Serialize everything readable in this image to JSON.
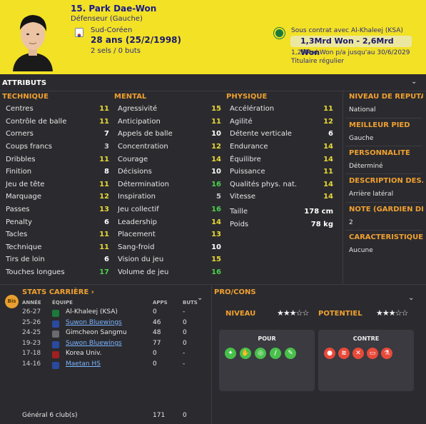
{
  "player": {
    "name": "15. Park Dae-Won",
    "position": "Défenseur (Gauche)",
    "nationality": "Sud-Coréen",
    "age": "28 ans (25/2/1998)",
    "caps": "2 sels / 0 buts",
    "contract": "Sous contrat avec Al-Khaleej (KSA)",
    "wage": "1,3Mrd Won - 2,6Mrd Won",
    "wage_detail": "1,28Mrd Won p/a jusqu'au 30/6/2029",
    "status": "Titulaire régulier"
  },
  "attributes": {
    "title": "ATTRIBUTS",
    "technique": {
      "title": "TECHNIQUE",
      "rows": [
        {
          "name": "Centres",
          "value": "11"
        },
        {
          "name": "Contrôle de balle",
          "value": "11"
        },
        {
          "name": "Corners",
          "value": "7"
        },
        {
          "name": "Coups francs",
          "value": "3"
        },
        {
          "name": "Dribbles",
          "value": "11"
        },
        {
          "name": "Finition",
          "value": "8"
        },
        {
          "name": "Jeu de tête",
          "value": "11"
        },
        {
          "name": "Marquage",
          "value": "12"
        },
        {
          "name": "Passes",
          "value": "13"
        },
        {
          "name": "Penalty",
          "value": "6"
        },
        {
          "name": "Tacles",
          "value": "11"
        },
        {
          "name": "Technique",
          "value": "11"
        },
        {
          "name": "Tirs de loin",
          "value": "6"
        },
        {
          "name": "Touches longues",
          "value": "17"
        }
      ]
    },
    "mental": {
      "title": "MENTAL",
      "rows": [
        {
          "name": "Agressivité",
          "value": "15"
        },
        {
          "name": "Anticipation",
          "value": "11"
        },
        {
          "name": "Appels de balle",
          "value": "10"
        },
        {
          "name": "Concentration",
          "value": "12"
        },
        {
          "name": "Courage",
          "value": "14"
        },
        {
          "name": "Décisions",
          "value": "10"
        },
        {
          "name": "Détermination",
          "value": "16"
        },
        {
          "name": "Inspiration",
          "value": "5"
        },
        {
          "name": "Jeu collectif",
          "value": "16"
        },
        {
          "name": "Leadership",
          "value": "14"
        },
        {
          "name": "Placement",
          "value": "13"
        },
        {
          "name": "Sang-froid",
          "value": "10"
        },
        {
          "name": "Vision du jeu",
          "value": "15"
        },
        {
          "name": "Volume de jeu",
          "value": "16"
        }
      ]
    },
    "physique": {
      "title": "PHYSIQUE",
      "rows": [
        {
          "name": "Accélération",
          "value": "11"
        },
        {
          "name": "Agilité",
          "value": "12"
        },
        {
          "name": "Détente verticale",
          "value": "6"
        },
        {
          "name": "Endurance",
          "value": "14"
        },
        {
          "name": "Équilibre",
          "value": "14"
        },
        {
          "name": "Puissance",
          "value": "11"
        },
        {
          "name": "Qualités phys. nat.",
          "value": "14"
        },
        {
          "name": "Vitesse",
          "value": "14"
        }
      ],
      "height_label": "Taille",
      "height": "178 cm",
      "weight_label": "Poids",
      "weight": "78 kg"
    }
  },
  "side": [
    {
      "title": "NIVEAU DE RÉPUTA...",
      "value": "National"
    },
    {
      "title": "MEILLEUR PIED",
      "value": "Gauche"
    },
    {
      "title": "PERSONNALITÉ",
      "value": "Déterminé"
    },
    {
      "title": "DESCRIPTION DES...",
      "value": "Arrière latéral"
    },
    {
      "title": "NOTE (GARDIEN DE...",
      "value": "2"
    },
    {
      "title": "CARACTÉRISTIQUES J",
      "value": "Aucune"
    }
  ],
  "career": {
    "badge": "Bis",
    "title": "STATS CARRIÈRE ›",
    "headers": {
      "year": "ANNÉE",
      "team": "ÉQUIPE",
      "apps": "APPS",
      "goals": "BUTS"
    },
    "rows": [
      {
        "year": "26-27",
        "club": "Al-Khaleej (KSA)",
        "apps": "0",
        "goals": "-",
        "link": false,
        "crest": "#1a7a3a"
      },
      {
        "year": "25-26",
        "club": "Suwon Bluewings",
        "apps": "46",
        "goals": "0",
        "link": true,
        "crest": "#2a4aa0"
      },
      {
        "year": "24-25",
        "club": "Gimcheon Sangmu",
        "apps": "48",
        "goals": "0",
        "link": false,
        "crest": "#6a6a70"
      },
      {
        "year": "19-23",
        "club": "Suwon Bluewings",
        "apps": "77",
        "goals": "0",
        "link": true,
        "crest": "#2a4aa0"
      },
      {
        "year": "17-18",
        "club": "Korea Univ.",
        "apps": "0",
        "goals": "-",
        "link": false,
        "crest": "#a02020"
      },
      {
        "year": "14-16",
        "club": "Maetan HS",
        "apps": "0",
        "goals": "-",
        "link": true,
        "crest": "#2a4aa0"
      }
    ],
    "total_label": "Général  6 club(s)",
    "total_apps": "171",
    "total_goals": "0"
  },
  "procons": {
    "title": "PRO/CONS",
    "level_label": "NIVEAU",
    "level_stars": "★★★☆☆",
    "potential_label": "POTENTIEL",
    "potential_stars": "★★★☆☆",
    "pros_title": "POUR",
    "cons_title": "CONTRE"
  }
}
